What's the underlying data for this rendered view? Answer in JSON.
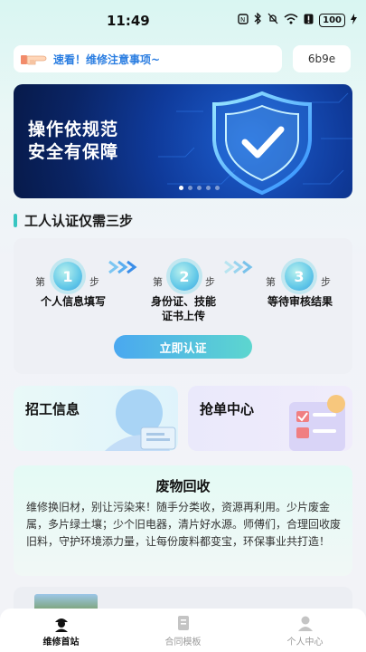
{
  "status_bar": {
    "time": "11:49",
    "battery": "100"
  },
  "notice": {
    "text": "速看！维修注意事项~",
    "code": "6b9e"
  },
  "banner": {
    "line1": "操作依规范",
    "line2": "安全有保障"
  },
  "section": {
    "title": "工人认证仅需三步"
  },
  "steps": {
    "prefix": "第",
    "suffix": "步",
    "items": [
      {
        "num": "1",
        "label": "个人信息填写"
      },
      {
        "num": "2",
        "label_line1": "身份证、技能",
        "label_line2": "证书上传"
      },
      {
        "num": "3",
        "label": "等待审核结果"
      }
    ],
    "button": "立即认证"
  },
  "quick": {
    "recruit": "招工信息",
    "grab": "抢单中心"
  },
  "waste": {
    "title": "废物回收",
    "body": "维修换旧材，别让污染来！随手分类收，资源再利用。少片废金属，多片绿土壤；少个旧电器，清片好水源。师傅们，合理回收废旧料，守护环境添力量，让每份废料都变宝，环保事业共打造！"
  },
  "tabbar": {
    "home": "维修首站",
    "contract": "合同模板",
    "profile": "个人中心"
  },
  "colors": {
    "accent": "#37c5c1",
    "link": "#2a7de1"
  }
}
